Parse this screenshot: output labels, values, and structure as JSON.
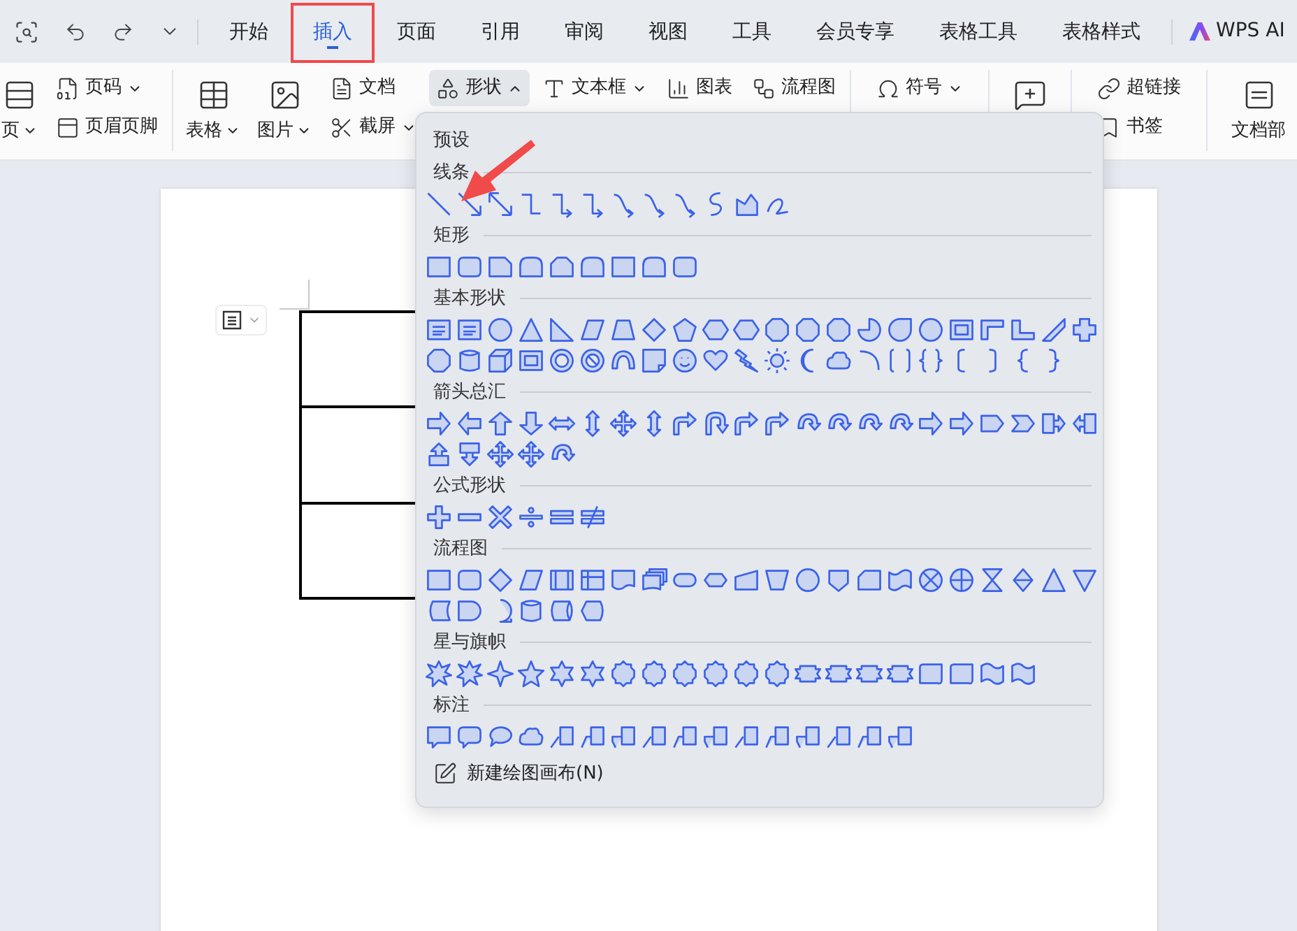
{
  "tabs": [
    {
      "label": "开始",
      "selected": false,
      "highlighted": false
    },
    {
      "label": "插入",
      "selected": true,
      "highlighted": true
    },
    {
      "label": "页面",
      "selected": false,
      "highlighted": false
    },
    {
      "label": "引用",
      "selected": false,
      "highlighted": false
    },
    {
      "label": "审阅",
      "selected": false,
      "highlighted": false
    },
    {
      "label": "视图",
      "selected": false,
      "highlighted": false
    },
    {
      "label": "工具",
      "selected": false,
      "highlighted": false
    },
    {
      "label": "会员专享",
      "selected": false,
      "highlighted": false
    },
    {
      "label": "表格工具",
      "selected": false,
      "highlighted": false
    },
    {
      "label": "表格样式",
      "selected": false,
      "highlighted": false
    }
  ],
  "ai_button": {
    "label": "WPS AI"
  },
  "ribbon": {
    "groups": [
      {
        "columns": [
          {
            "kind": "large",
            "items": [
              {
                "label": "页",
                "dropdown": true,
                "expanded": false
              }
            ]
          },
          {
            "kind": "small",
            "items": [
              {
                "label": "页码",
                "dropdown": true,
                "expanded": false
              },
              {
                "label": "页眉页脚",
                "dropdown": false,
                "expanded": false
              }
            ]
          }
        ]
      },
      {
        "columns": [
          {
            "kind": "large",
            "items": [
              {
                "label": "表格",
                "dropdown": true,
                "expanded": false
              }
            ]
          },
          {
            "kind": "large",
            "items": [
              {
                "label": "图片",
                "dropdown": true,
                "expanded": false
              }
            ]
          },
          {
            "kind": "small",
            "items": [
              {
                "label": "文档",
                "dropdown": false,
                "expanded": false
              },
              {
                "label": "截屏",
                "dropdown": true,
                "expanded": false
              }
            ]
          },
          {
            "kind": "small",
            "items": [
              {
                "label": "形状",
                "dropdown": true,
                "expanded": true
              }
            ]
          },
          {
            "kind": "small",
            "items": [
              {
                "label": "文本框",
                "dropdown": true,
                "expanded": false
              }
            ]
          },
          {
            "kind": "small",
            "items": [
              {
                "label": "图表",
                "dropdown": false,
                "expanded": false
              }
            ]
          },
          {
            "kind": "small",
            "items": [
              {
                "label": "流程图",
                "dropdown": false,
                "expanded": false
              }
            ]
          }
        ]
      },
      {
        "columns": [
          {
            "kind": "small",
            "items": [
              {
                "label": "符号",
                "dropdown": true,
                "expanded": false
              }
            ]
          }
        ]
      },
      {
        "columns": [
          {
            "kind": "icon"
          }
        ]
      },
      {
        "columns": [
          {
            "kind": "small",
            "items": [
              {
                "label": "超链接",
                "dropdown": false,
                "expanded": false
              },
              {
                "label": "书签",
                "dropdown": false,
                "expanded": false
              }
            ]
          }
        ]
      },
      {
        "columns": [
          {
            "kind": "large",
            "items": [
              {
                "label": "文档部",
                "dropdown": false,
                "expanded": false
              }
            ]
          }
        ]
      }
    ]
  },
  "shape_menu": {
    "sections": [
      {
        "title": "预设"
      },
      {
        "title": "线条",
        "kind": "lines"
      },
      {
        "title": "矩形",
        "kind": "rectangles"
      },
      {
        "title": "基本形状",
        "kind": "basic"
      },
      {
        "title": "箭头总汇",
        "kind": "arrows"
      },
      {
        "title": "公式形状",
        "kind": "equation"
      },
      {
        "title": "流程图",
        "kind": "flowchart"
      },
      {
        "title": "星与旗帜",
        "kind": "stars"
      },
      {
        "title": "标注",
        "kind": "callouts"
      }
    ],
    "footer": {
      "label": "新建绘图画布(N)"
    }
  },
  "annotation_arrow": true
}
